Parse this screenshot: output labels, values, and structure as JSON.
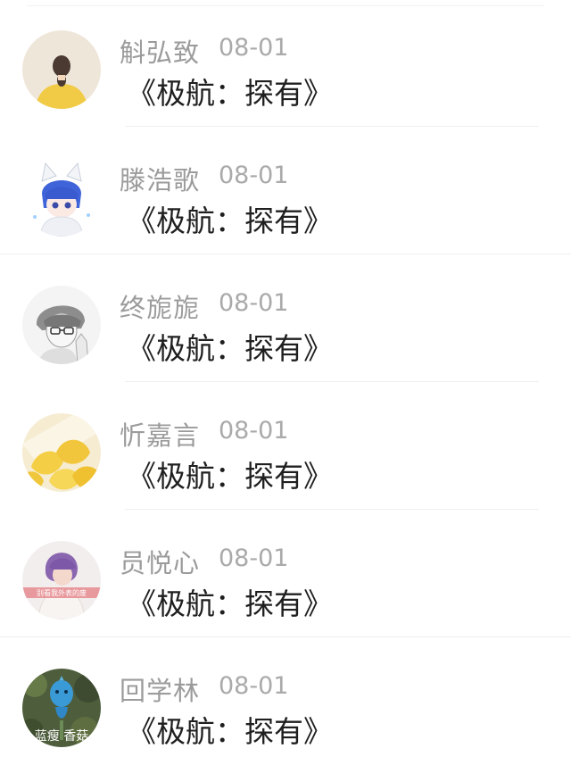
{
  "comments": [
    {
      "author": "斛弘致",
      "date": "08-01",
      "text": "《极航：探有》",
      "avatar": "girl-back-yellow-avatar"
    },
    {
      "author": "滕浩歌",
      "date": "08-01",
      "text": "《极航：探有》",
      "avatar": "anime-catboy-avatar"
    },
    {
      "author": "终旎旎",
      "date": "08-01",
      "text": "《极航：探有》",
      "avatar": "sketch-boy-glasses-avatar"
    },
    {
      "author": "忻嘉言",
      "date": "08-01",
      "text": "《极航：探有》",
      "avatar": "ginkgo-leaves-avatar"
    },
    {
      "author": "员悦心",
      "date": "08-01",
      "text": "《极航：探有》",
      "avatar": "purple-hair-girl-avatar",
      "avatar_caption": "别看我外表的废"
    },
    {
      "author": "回学林",
      "date": "08-01",
      "text": "《极航：探有》",
      "avatar": "blue-figure-plant-avatar",
      "avatar_caption": "蓝瘦 香菇"
    }
  ]
}
